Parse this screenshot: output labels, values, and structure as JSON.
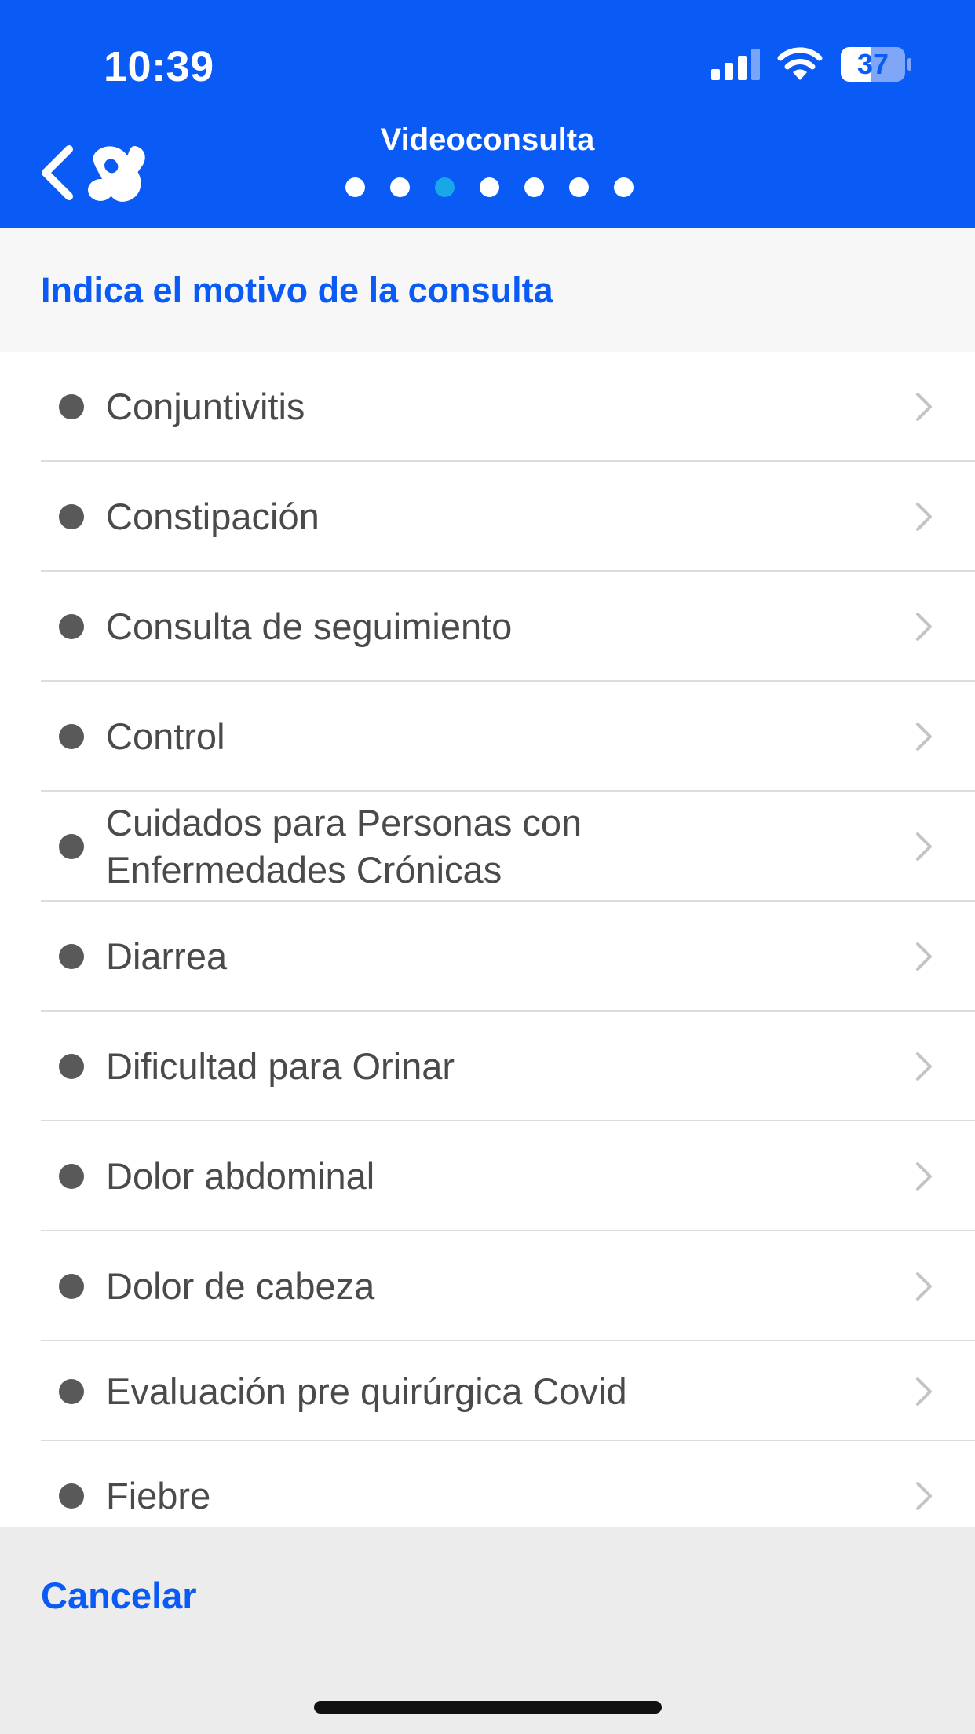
{
  "status_bar": {
    "time": "10:39",
    "battery": "37"
  },
  "header": {
    "title": "Videoconsulta",
    "steps_total": 7,
    "current_step": 3,
    "background_color": "#0a5af5",
    "active_dot_color": "#1aa7e8"
  },
  "subheader": {
    "title": "Indica el motivo de la consulta"
  },
  "list": {
    "items": [
      {
        "label": "Conjuntivitis"
      },
      {
        "label": "Constipación"
      },
      {
        "label": "Consulta de seguimiento"
      },
      {
        "label": "Control"
      },
      {
        "label": "Cuidados para Personas con Enfermedades Crónicas"
      },
      {
        "label": "Diarrea"
      },
      {
        "label": "Dificultad para Orinar"
      },
      {
        "label": "Dolor abdominal"
      },
      {
        "label": "Dolor de cabeza"
      },
      {
        "label": "Evaluación pre quirúrgica Covid"
      },
      {
        "label": "Fiebre"
      }
    ]
  },
  "footer": {
    "cancel_label": "Cancelar"
  }
}
